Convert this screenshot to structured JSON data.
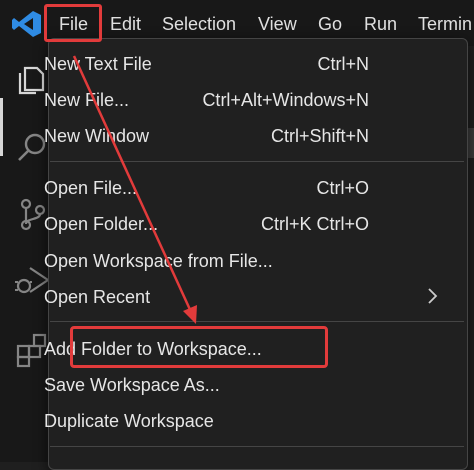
{
  "menubar": {
    "items": [
      {
        "label": "File"
      },
      {
        "label": "Edit"
      },
      {
        "label": "Selection"
      },
      {
        "label": "View"
      },
      {
        "label": "Go"
      },
      {
        "label": "Run"
      },
      {
        "label": "Termin"
      }
    ]
  },
  "file_menu": {
    "groups": [
      [
        {
          "label": "New Text File",
          "shortcut": "Ctrl+N"
        },
        {
          "label": "New File...",
          "shortcut": "Ctrl+Alt+Windows+N"
        },
        {
          "label": "New Window",
          "shortcut": "Ctrl+Shift+N"
        }
      ],
      [
        {
          "label": "Open File...",
          "shortcut": "Ctrl+O"
        },
        {
          "label": "Open Folder...",
          "shortcut": "Ctrl+K Ctrl+O"
        },
        {
          "label": "Open Workspace from File...",
          "shortcut": ""
        },
        {
          "label": "Open Recent",
          "shortcut": "",
          "submenu": true
        }
      ],
      [
        {
          "label": "Add Folder to Workspace...",
          "shortcut": ""
        },
        {
          "label": "Save Workspace As...",
          "shortcut": ""
        },
        {
          "label": "Duplicate Workspace",
          "shortcut": ""
        }
      ]
    ]
  },
  "icons": {
    "logo": "vscode-logo-icon",
    "activity": [
      "explorer-icon",
      "search-icon",
      "source-control-icon",
      "run-debug-icon",
      "extensions-icon"
    ],
    "submenu": "chevron-right-icon"
  },
  "colors": {
    "highlight": "#e23b3b",
    "accent": "#2f8be3"
  }
}
